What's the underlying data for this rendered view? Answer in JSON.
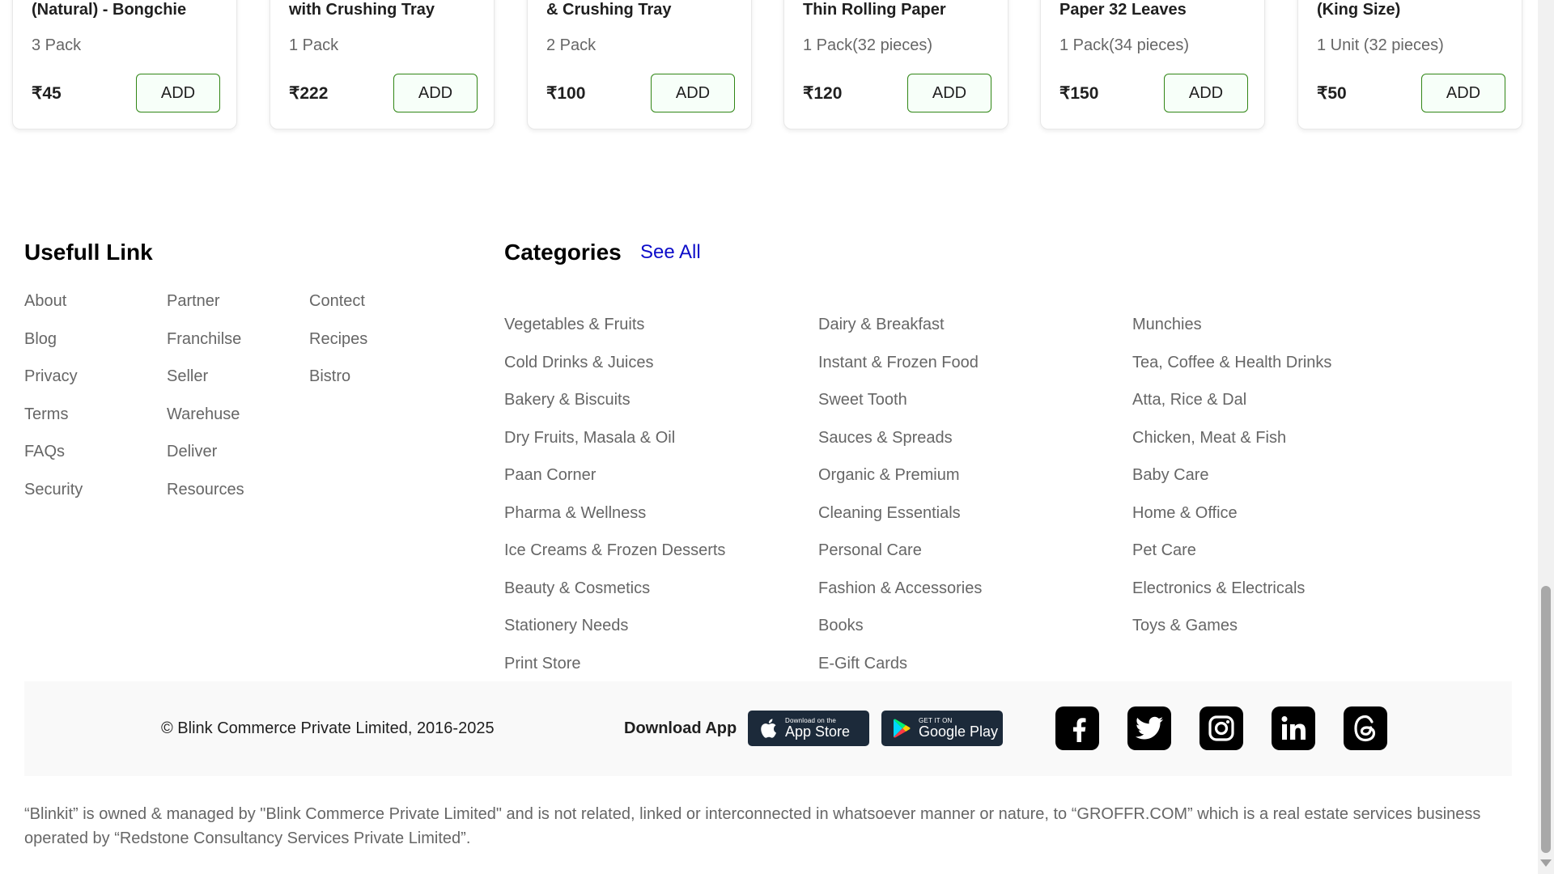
{
  "products": [
    {
      "title": "(Natural) - Bongchie",
      "qty": "3 Pack",
      "price": "₹45",
      "add_label": "ADD"
    },
    {
      "title": "with Crushing Tray",
      "qty": "1 Pack",
      "price": "₹222",
      "add_label": "ADD"
    },
    {
      "title": "& Crushing Tray",
      "qty": "2 Pack",
      "price": "₹100",
      "add_label": "ADD"
    },
    {
      "title": "Thin Rolling Paper",
      "qty": "1 Pack(32 pieces)",
      "price": "₹120",
      "add_label": "ADD"
    },
    {
      "title": "Paper 32 Leaves",
      "qty": "1 Pack(34 pieces)",
      "price": "₹150",
      "add_label": "ADD"
    },
    {
      "title": "(King Size)",
      "qty": "1 Unit (32 pieces)",
      "price": "₹50",
      "add_label": "ADD"
    }
  ],
  "useful_links": {
    "title": "Usefull Link",
    "col1": [
      "About",
      "Blog",
      "Privacy",
      "Terms",
      "FAQs",
      "Security"
    ],
    "col2": [
      "Partner",
      "Franchilse",
      "Seller",
      "Warehuse",
      "Deliver",
      "Resources"
    ],
    "col3": [
      "Contect",
      "Recipes",
      "Bistro"
    ]
  },
  "categories": {
    "title": "Categories",
    "see_all": "See All",
    "col1": [
      "Vegetables & Fruits",
      "Cold Drinks & Juices",
      "Bakery & Biscuits",
      "Dry Fruits, Masala & Oil",
      "Paan Corner",
      "Pharma & Wellness",
      "Ice Creams & Frozen Desserts",
      "Beauty & Cosmetics",
      "Stationery Needs",
      "Print Store"
    ],
    "col2": [
      "Dairy & Breakfast",
      "Instant & Frozen Food",
      "Sweet Tooth",
      "Sauces & Spreads",
      "Organic & Premium",
      "Cleaning Essentials",
      "Personal Care",
      "Fashion & Accessories",
      "Books",
      "E-Gift Cards"
    ],
    "col3": [
      "Munchies",
      "Tea, Coffee & Health Drinks",
      "Atta, Rice & Dal",
      "Chicken, Meat & Fish",
      "Baby Care",
      "Home & Office",
      "Pet Care",
      "Electronics & Electricals",
      "Toys & Games"
    ]
  },
  "footer": {
    "copyright": "© Blink Commerce Private Limited, 2016-2025",
    "download_label": "Download App",
    "app_store": {
      "small": "Download on the",
      "big": "App Store"
    },
    "google_play": {
      "small": "GET IT ON",
      "big": "Google Play"
    },
    "social_icons": [
      "facebook-icon",
      "twitter-icon",
      "instagram-icon",
      "linkedin-icon",
      "threads-icon"
    ],
    "disclaimer": "“Blinkit” is owned & managed by \"Blink Commerce Private Limited\" and is not related, linked or interconnected in whatsoever manner or nature, to “GROFFR.COM” which is a real estate services business operated by “Redstone Consultancy Services Private Limited”."
  },
  "colors": {
    "add_border": "#318616",
    "see_all": "#0c0cc9",
    "badge_bg": "#1c2a3a"
  }
}
